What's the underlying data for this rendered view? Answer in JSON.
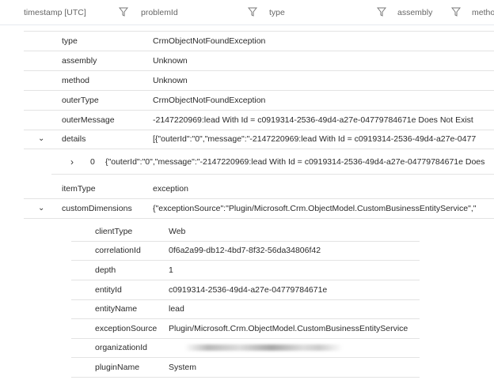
{
  "header": {
    "columns": [
      "timestamp [UTC]",
      "problemId",
      "type",
      "assembly",
      "metho"
    ]
  },
  "rows": [
    {
      "key": "type",
      "value": "CrmObjectNotFoundException"
    },
    {
      "key": "assembly",
      "value": "Unknown"
    },
    {
      "key": "method",
      "value": "Unknown"
    },
    {
      "key": "outerType",
      "value": "CrmObjectNotFoundException"
    },
    {
      "key": "outerMessage",
      "value": "-2147220969:lead With Id = c0919314-2536-49d4-a27e-04779784671e Does Not Exist"
    },
    {
      "key": "details",
      "value": "[{\"outerId\":\"0\",\"message\":\"-2147220969:lead With Id = c0919314-2536-49d4-a27e-0477"
    },
    {
      "key": "itemType",
      "value": "exception"
    },
    {
      "key": "customDimensions",
      "value": "{\"exceptionSource\":\"Plugin/Microsoft.Crm.ObjectModel.CustomBusinessEntityService\",\""
    }
  ],
  "details_item": {
    "index": "0",
    "value": "{\"outerId\":\"0\",\"message\":\"-2147220969:lead With Id = c0919314-2536-49d4-a27e-04779784671e Does"
  },
  "custom_dimensions": [
    {
      "key": "clientType",
      "value": "Web"
    },
    {
      "key": "correlationId",
      "value": "0f6a2a99-db12-4bd7-8f32-56da34806f42"
    },
    {
      "key": "depth",
      "value": "1"
    },
    {
      "key": "entityId",
      "value": "c0919314-2536-49d4-a27e-04779784671e"
    },
    {
      "key": "entityName",
      "value": "lead"
    },
    {
      "key": "exceptionSource",
      "value": "Plugin/Microsoft.Crm.ObjectModel.CustomBusinessEntityService"
    },
    {
      "key": "organizationId",
      "value": ""
    },
    {
      "key": "pluginName",
      "value": "System"
    }
  ]
}
